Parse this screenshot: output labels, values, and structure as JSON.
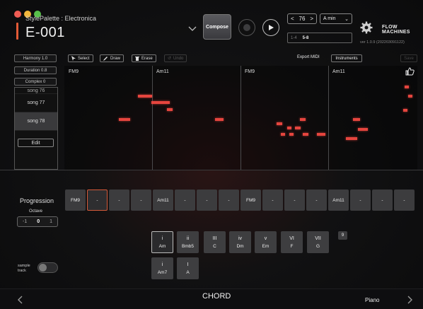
{
  "window": {
    "style_label": "StylePalette : Electronica",
    "song_title": "E-001"
  },
  "header": {
    "compose_label": "Compose",
    "tempo": "76",
    "key": "A min",
    "section_a": "1-4",
    "section_b": "5-8",
    "brand": "FLOW MACHINES",
    "version": "ver 1.0.9 (202203091122)"
  },
  "sidebar": {
    "harmony": "Harmony 1.0",
    "duration": "Duration  0.8",
    "complex": "Complex 0",
    "songs": [
      "song 76",
      "song 77",
      "song 78"
    ],
    "selected_song": "song 78",
    "edit_label": "Edit"
  },
  "toolbar": {
    "select_label": "Select",
    "draw_label": "Draw",
    "erase_label": "Erase",
    "undo_label": "Undo",
    "export_label": "Export MIDI",
    "instruments_label": "Instruments",
    "save_label": "Save"
  },
  "piano_roll": {
    "bar_chords": [
      "FM9",
      "Am11",
      "FM9",
      "Am11"
    ]
  },
  "progression": {
    "label": "Progression",
    "slots": [
      "FM9",
      "-",
      "-",
      "-",
      "Am11",
      "-",
      "-",
      "-",
      "FM9",
      "-",
      "-",
      "-",
      "Am11",
      "-",
      "-",
      "-"
    ],
    "octave_label": "Octave",
    "octave_minus": "-1",
    "octave_value": "0",
    "octave_plus": "1"
  },
  "chord_palette": {
    "row1": [
      {
        "degree": "i",
        "name": "Am"
      },
      {
        "degree": "ii",
        "name": "Bmb5"
      },
      {
        "degree": "III",
        "name": "C"
      },
      {
        "degree": "iv",
        "name": "Dm"
      },
      {
        "degree": "v",
        "name": "Em"
      },
      {
        "degree": "VI",
        "name": "F"
      },
      {
        "degree": "VII",
        "name": "G"
      }
    ],
    "row2": [
      {
        "degree": "i",
        "name": "Am7"
      },
      {
        "degree": "I",
        "name": "A"
      }
    ],
    "extra_badge": "9"
  },
  "sample_track": {
    "label": "sample track"
  },
  "footer": {
    "title": "CHORD",
    "instrument": "Piano"
  },
  "colors": {
    "accent": "#e35a36",
    "note": "#e5453e",
    "selected_slot_border": "#d55a3a"
  },
  "icons": [
    "chevron-down-icon",
    "record-icon",
    "play-icon",
    "gear-icon",
    "thumbs-up-icon",
    "cursor-icon",
    "pencil-icon",
    "trash-icon",
    "undo-icon",
    "chevron-left-icon",
    "chevron-right-icon"
  ]
}
